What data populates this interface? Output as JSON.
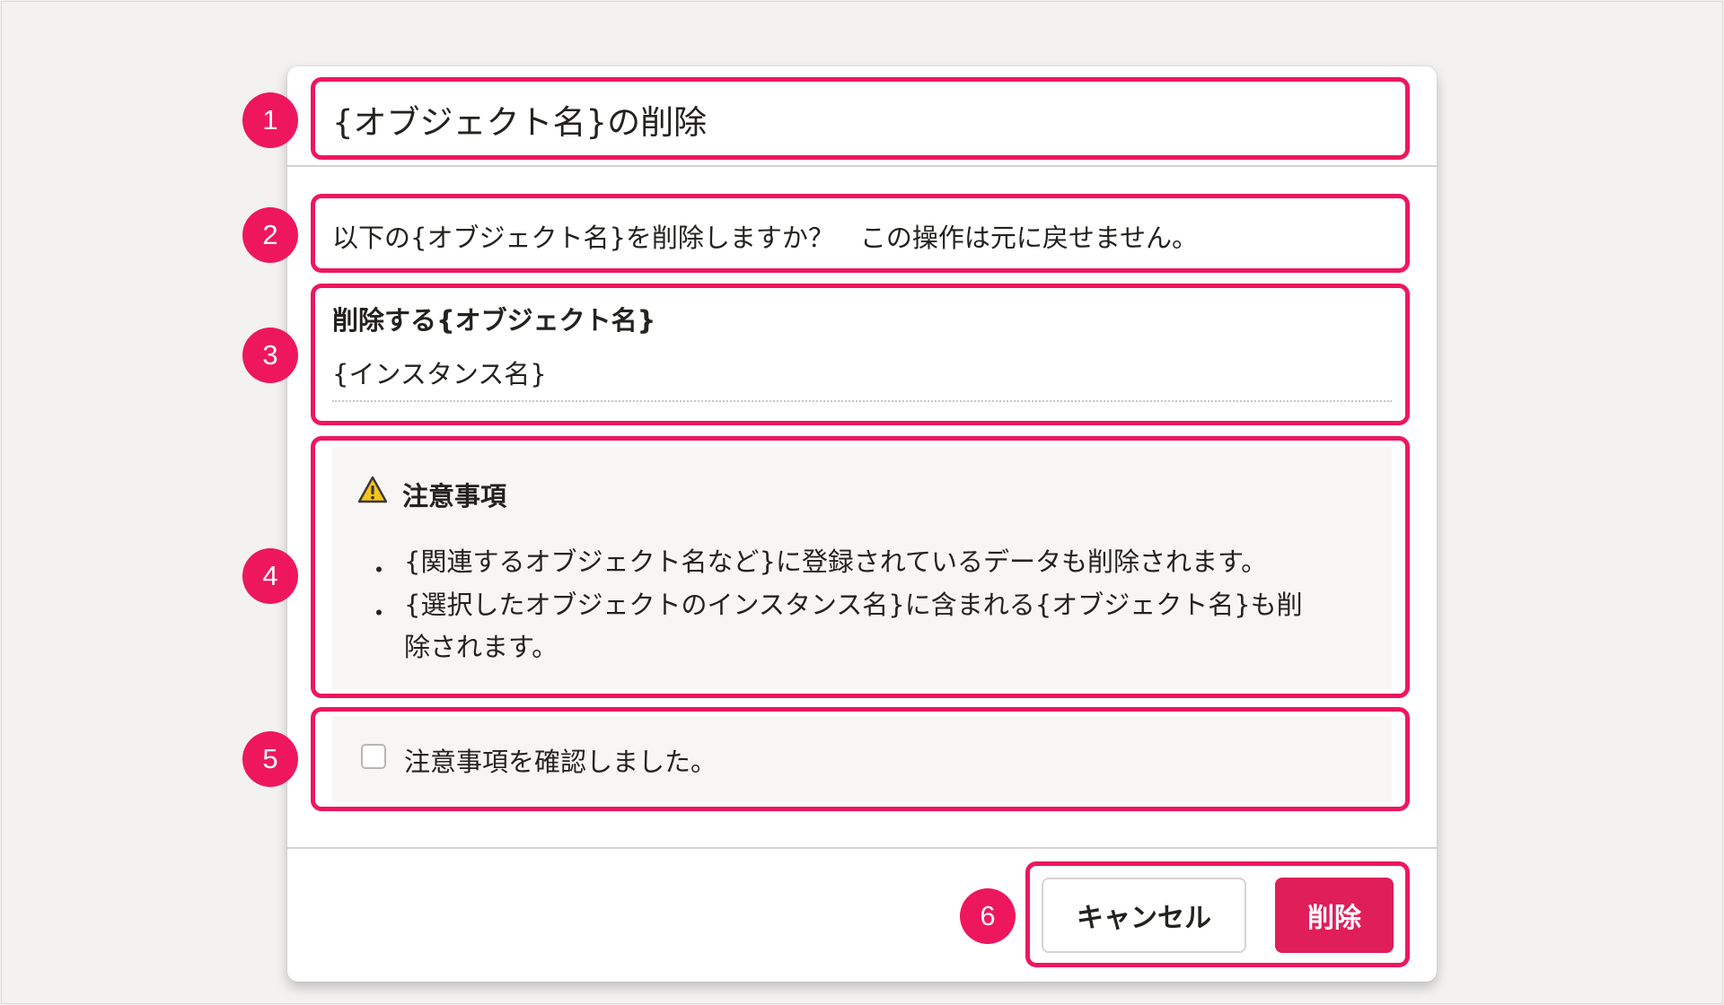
{
  "dialog": {
    "title": "{オブジェクト名}の削除",
    "message": "以下の{オブジェクト名}を削除しますか？　この操作は元に戻せません。",
    "target": {
      "label": "削除する{オブジェクト名}",
      "value": "{インスタンス名}"
    },
    "notice": {
      "heading": "注意事項",
      "icon": "warning-icon",
      "bullet_glyph": "・",
      "items": [
        {
          "lines": [
            "{関連するオブジェクト名など}に登録されているデータも削除されます。"
          ]
        },
        {
          "lines": [
            "{選択したオブジェクトのインスタンス名}に含まれる{オブジェクト名}も削",
            "除されます。"
          ]
        }
      ]
    },
    "confirm_checkbox": {
      "label": "注意事項を確認しました。",
      "checked": false
    },
    "footer": {
      "cancel_label": "キャンセル",
      "delete_label": "削除"
    }
  },
  "annotations": {
    "badges": [
      "1",
      "2",
      "3",
      "4",
      "5",
      "6"
    ],
    "highlight_color": "#ee175d"
  },
  "colors": {
    "danger": "#e01e5a",
    "warning": "#f5c518",
    "notice_background": "#f7f6f4"
  }
}
